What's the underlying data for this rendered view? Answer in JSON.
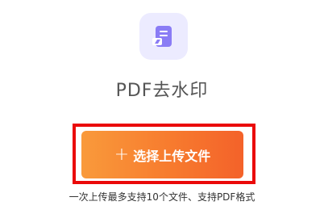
{
  "tool": {
    "icon": "pdf-document-eraser-icon",
    "title": "PDF去水印"
  },
  "upload": {
    "icon": "plus-icon",
    "label": "选择上传文件"
  },
  "hint": "一次上传最多支持10个文件、支持PDF格式",
  "colors": {
    "icon_tile_bg": "#ecebff",
    "icon_accent": "#8a7cf5",
    "button_gradient_start": "#f99a3b",
    "button_gradient_end": "#f4622a",
    "highlight_border": "#ea0a0a",
    "title_text": "#555555"
  }
}
